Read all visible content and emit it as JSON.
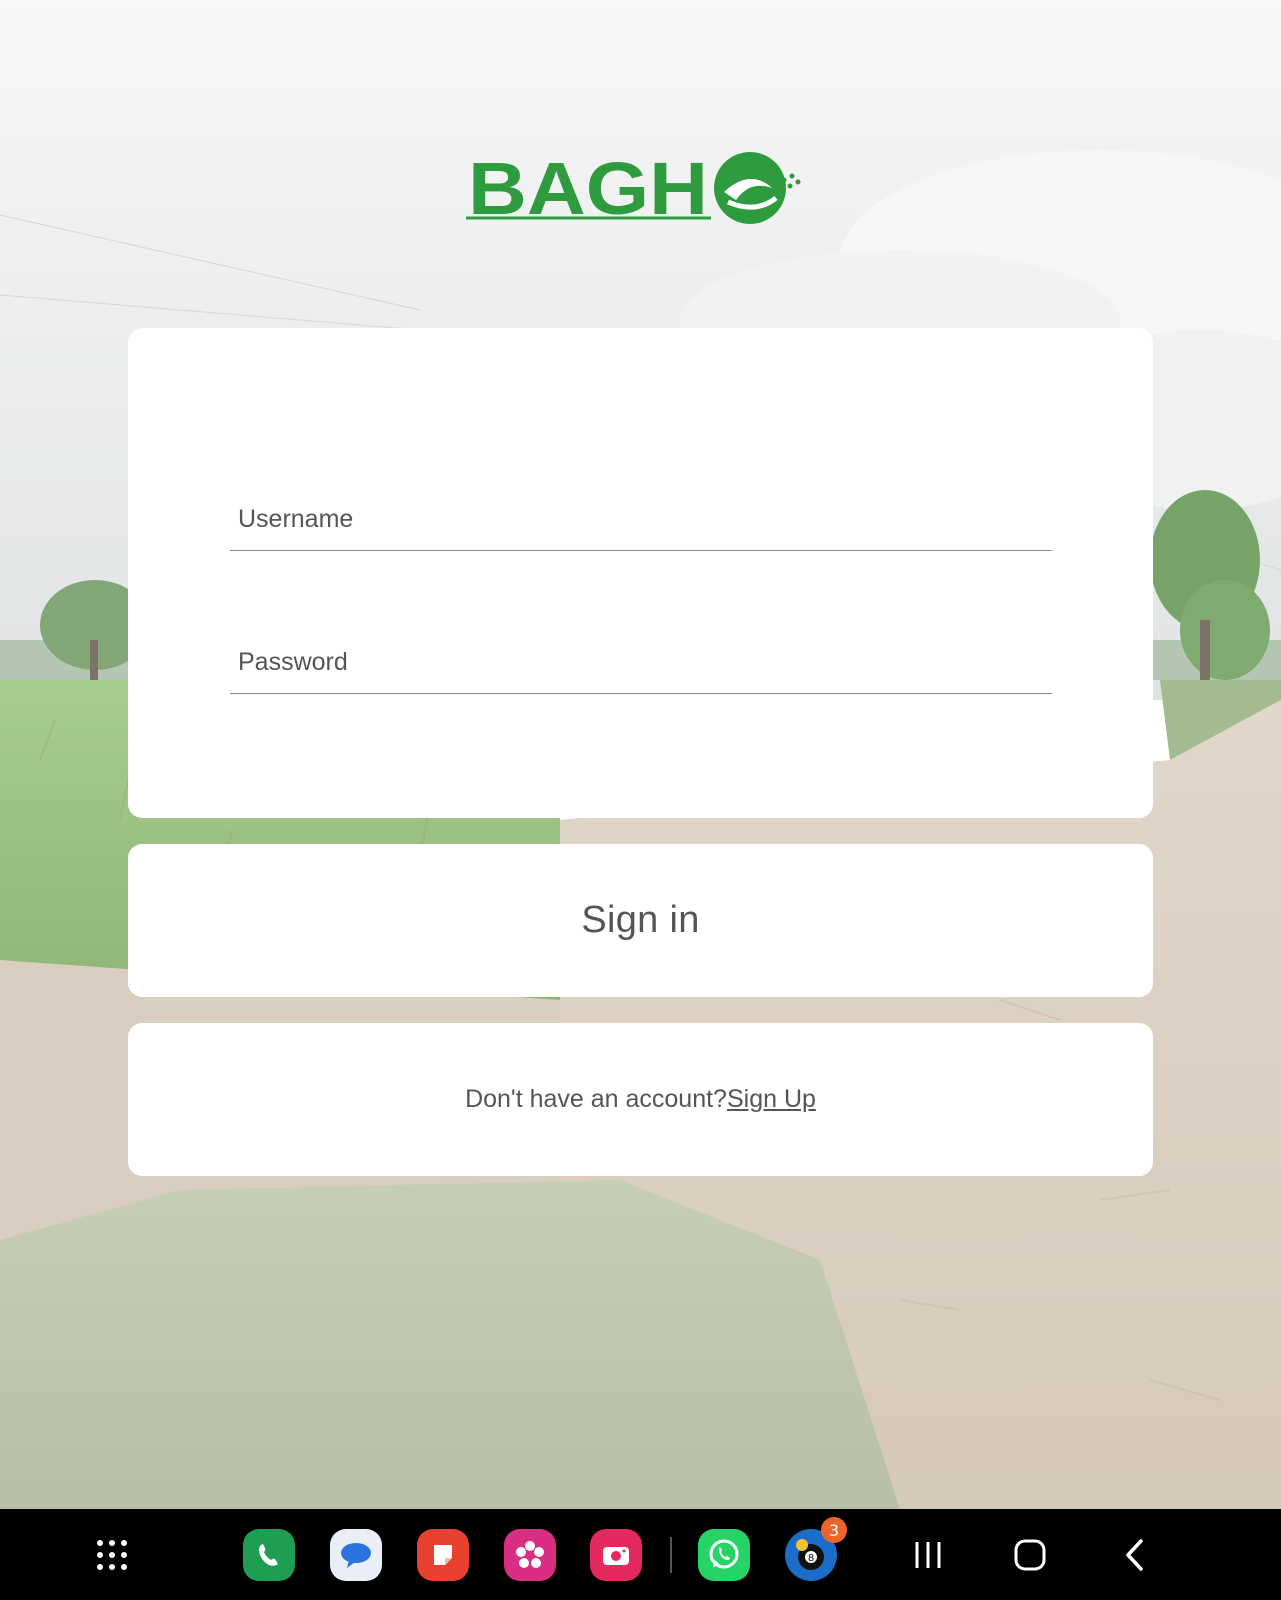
{
  "brand": {
    "logo_text": "BAGHe",
    "color": "#2e9b3e"
  },
  "login": {
    "username_placeholder": "Username",
    "password_placeholder": "Password"
  },
  "actions": {
    "signin_label": "Sign in",
    "signup_prompt": "Don't have an account?",
    "signup_link": "Sign Up"
  },
  "taskbar": {
    "apps": [
      {
        "name": "phone-icon",
        "color": "#1e9e53"
      },
      {
        "name": "messages-icon",
        "color": "#e9eef7"
      },
      {
        "name": "notes-icon",
        "color": "#e8412f"
      },
      {
        "name": "gallery-icon",
        "color": "#d92e83"
      },
      {
        "name": "camera-icon",
        "color": "#e2285c"
      },
      {
        "name": "whatsapp-icon",
        "color": "#25d366"
      },
      {
        "name": "pool-game-icon",
        "color": "#1c6dc9"
      }
    ],
    "game_badge": "3"
  }
}
